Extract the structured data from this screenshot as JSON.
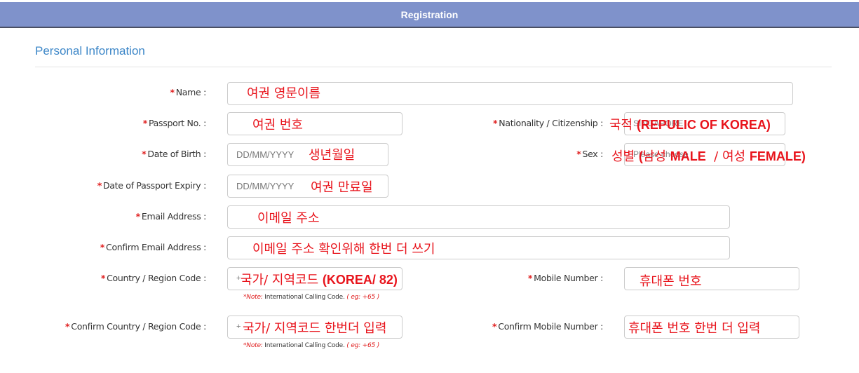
{
  "header": {
    "title": "Registration"
  },
  "section": {
    "title": "Personal Information"
  },
  "required_marker": "*",
  "fields": {
    "name": {
      "label": "Name :",
      "annotation": "여권 영문이름"
    },
    "passport_no": {
      "label": "Passport No. :",
      "annotation": "여권 번호"
    },
    "nationality": {
      "label": "Nationality / Citizenship :",
      "value": "SINGAPORE",
      "annotation_ko": "국적",
      "annotation_en": "(REPULIC OF KOREA)"
    },
    "dob": {
      "label": "Date of Birth :",
      "placeholder": "DD/MM/YYYY",
      "annotation": "생년월일"
    },
    "sex": {
      "label": "Sex :",
      "value": "Please choose",
      "annotation_ko1": "성별",
      "annotation_paren": "(",
      "annotation_ko2": "남성",
      "annotation_en1": "MALE",
      "annotation_sep": "/",
      "annotation_ko3": "여성",
      "annotation_en2": "FEMALE)"
    },
    "passport_expiry": {
      "label": "Date of Passport Expiry :",
      "placeholder": "DD/MM/YYYY",
      "annotation": "여권 만료일"
    },
    "email": {
      "label": "Email Address :",
      "annotation": "이메일 주소"
    },
    "confirm_email": {
      "label": "Confirm Email Address :",
      "annotation": "이메일 주소 확인위해 한번 더 쓰기"
    },
    "country_code": {
      "label": "Country / Region Code :",
      "prefix": "+",
      "annotation_ko": "국가/ 지역코드",
      "annotation_en": "(KOREA/ 82)"
    },
    "mobile": {
      "label": "Mobile Number :",
      "annotation": "휴대폰 번호"
    },
    "confirm_country_code": {
      "label": "Confirm Country / Region Code :",
      "prefix": "+",
      "annotation": "국가/ 지역코드 한번더 입력"
    },
    "confirm_mobile": {
      "label": "Confirm Mobile Number :",
      "annotation": "휴대폰 번호 한번 더 입력"
    }
  },
  "note": {
    "prefix": "*Note:",
    "text": " International Calling Code. ",
    "example": "( eg: +65 )"
  },
  "colors": {
    "header_bg": "#7f92cb",
    "section_title": "#3d87c8",
    "required": "#e02020",
    "annotation": "#e8141c"
  }
}
